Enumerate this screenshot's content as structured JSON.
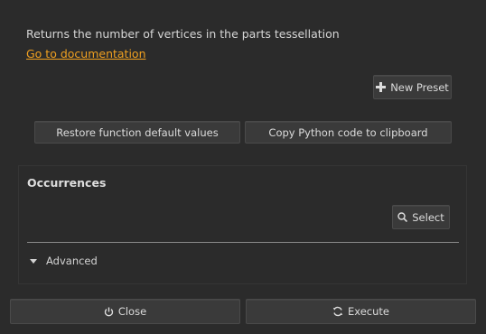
{
  "function": {
    "description": "Returns the number of vertices in the parts tessellation",
    "doc_link": "Go to documentation"
  },
  "presets": {
    "new_preset_label": "New Preset",
    "new_preset_icon": "plus-icon"
  },
  "actions": {
    "restore_label": "Restore function default values",
    "copy_label": "Copy Python code to clipboard"
  },
  "occurrences": {
    "title": "Occurrences",
    "select_label": "Select",
    "select_icon": "search-icon"
  },
  "advanced": {
    "label": "Advanced",
    "expanded": false
  },
  "footer": {
    "close_label": "Close",
    "close_icon": "power-icon",
    "execute_label": "Execute",
    "execute_icon": "refresh-icon"
  },
  "colors": {
    "background": "#2b2b2b",
    "link": "#f0a020",
    "button": "#3a3a3a"
  }
}
